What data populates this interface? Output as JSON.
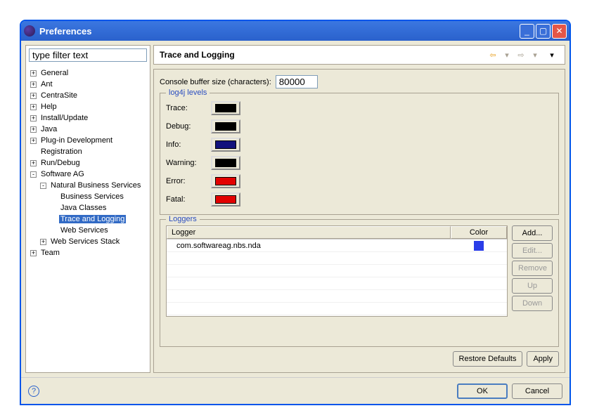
{
  "window": {
    "title": "Preferences"
  },
  "filter": {
    "placeholder": "type filter text"
  },
  "tree": {
    "general": "General",
    "ant": "Ant",
    "centrasite": "CentraSite",
    "help": "Help",
    "install": "Install/Update",
    "java": "Java",
    "plugindev": "Plug-in Development",
    "registration": "Registration",
    "rundebug": "Run/Debug",
    "softwareag": "Software AG",
    "nbs": "Natural Business Services",
    "bizservices": "Business Services",
    "javaclasses": "Java Classes",
    "tracelogging": "Trace and Logging",
    "webservices": "Web Services",
    "wsstack": "Web Services Stack",
    "team": "Team"
  },
  "page": {
    "title": "Trace and Logging",
    "bufferLabel": "Console buffer size (characters):",
    "bufferValue": "80000"
  },
  "levels": {
    "legend": "log4j levels",
    "items": [
      {
        "label": "Trace:",
        "color": "#000000"
      },
      {
        "label": "Debug:",
        "color": "#000000"
      },
      {
        "label": "Info:",
        "color": "#12127c"
      },
      {
        "label": "Warning:",
        "color": "#000000"
      },
      {
        "label": "Error:",
        "color": "#e20000"
      },
      {
        "label": "Fatal:",
        "color": "#e20000"
      }
    ]
  },
  "loggers": {
    "legend": "Loggers",
    "colHeader": {
      "logger": "Logger",
      "color": "Color"
    },
    "rows": [
      {
        "name": "com.softwareag.nbs.nda",
        "color": "#2a3de8"
      }
    ],
    "buttons": {
      "add": "Add...",
      "edit": "Edit...",
      "remove": "Remove",
      "up": "Up",
      "down": "Down"
    }
  },
  "buttons": {
    "restore": "Restore Defaults",
    "apply": "Apply",
    "ok": "OK",
    "cancel": "Cancel"
  }
}
